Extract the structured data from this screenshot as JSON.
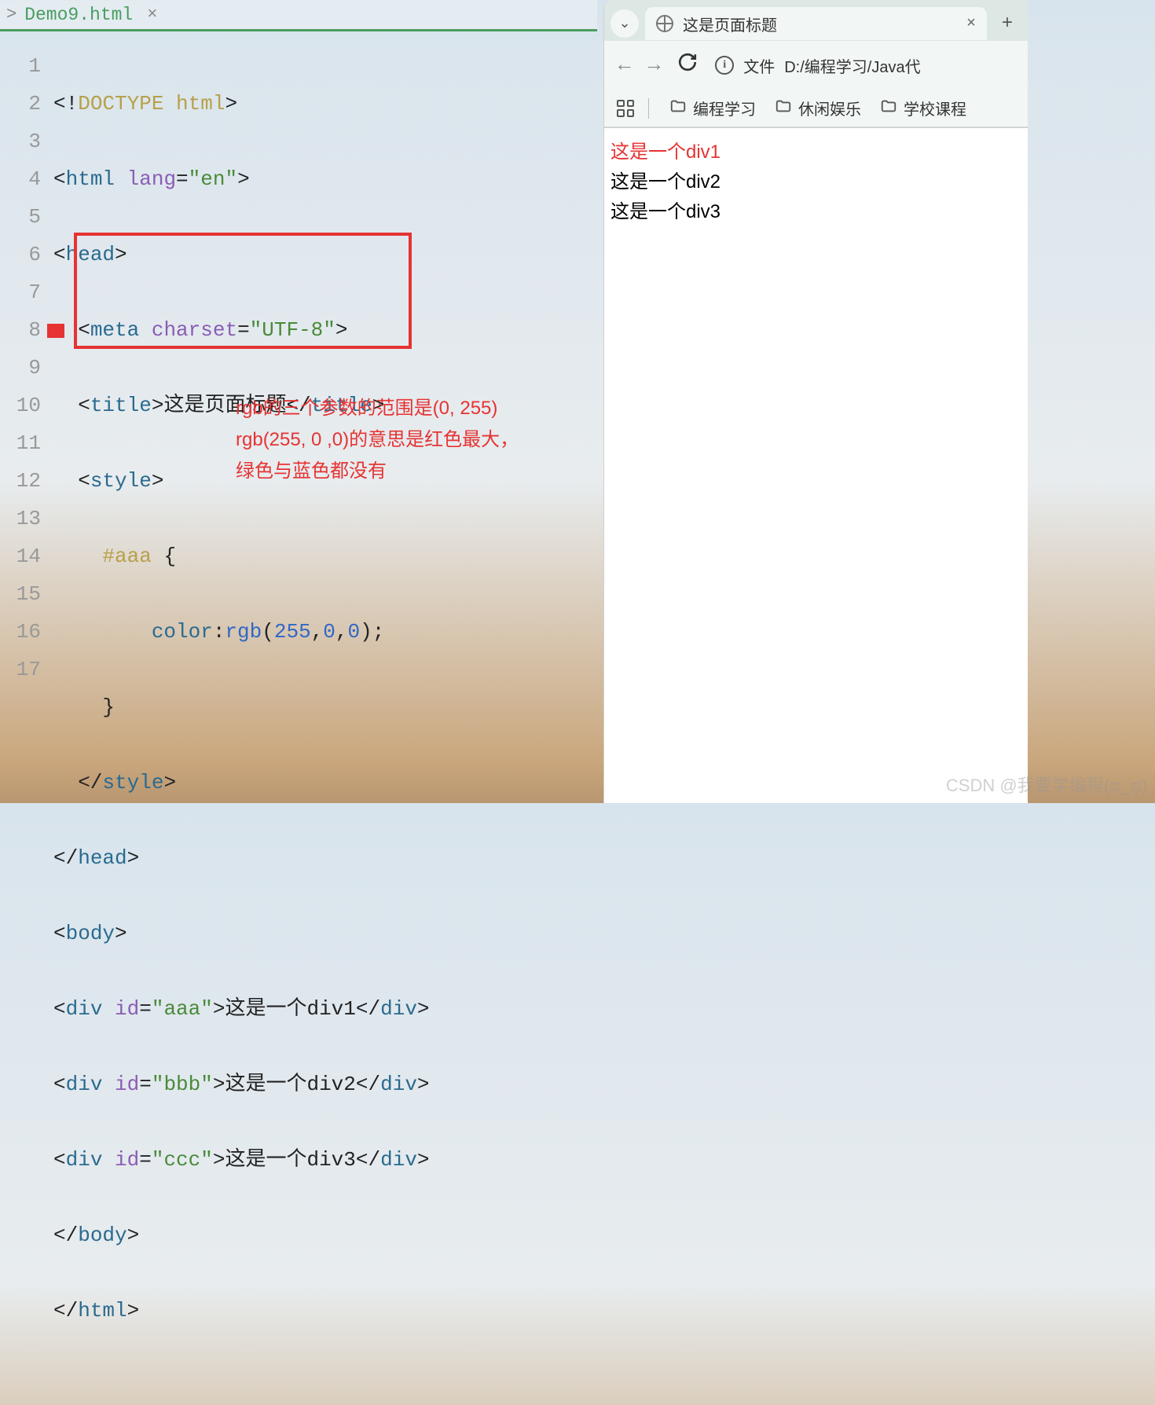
{
  "editor": {
    "tab_bread": ">",
    "tab_name": "Demo9.html",
    "tab_close": "×",
    "line_numbers": [
      "1",
      "2",
      "3",
      "4",
      "5",
      "6",
      "7",
      "8",
      "9",
      "10",
      "11",
      "12",
      "13",
      "14",
      "15",
      "16",
      "17"
    ],
    "code_tokens": [
      [
        "<!",
        "DOCTYPE html",
        ">"
      ],
      [
        "<",
        "html",
        " lang",
        "=",
        "\"en\"",
        ">"
      ],
      [
        "<",
        "head",
        ">"
      ],
      [
        "  <",
        "meta",
        " charset",
        "=",
        "\"UTF-8\"",
        ">"
      ],
      [
        "  <",
        "title",
        ">",
        "这是页面标题",
        "</",
        "title",
        ">"
      ],
      [
        "  <",
        "style",
        ">"
      ],
      [
        "    ",
        "#aaa",
        " {"
      ],
      [
        "        ",
        "color",
        ":",
        "rgb",
        "(",
        "255",
        ",",
        "0",
        ",",
        "0",
        ");"
      ],
      [
        "    }"
      ],
      [
        "  </",
        "style",
        ">"
      ],
      [
        "</",
        "head",
        ">"
      ],
      [
        "<",
        "body",
        ">"
      ],
      [
        "<",
        "div",
        " id",
        "=",
        "\"aaa\"",
        ">",
        "这是一个div1",
        "</",
        "div",
        ">"
      ],
      [
        "<",
        "div",
        " id",
        "=",
        "\"bbb\"",
        ">",
        "这是一个div2",
        "</",
        "div",
        ">"
      ],
      [
        "<",
        "div",
        " id",
        "=",
        "\"ccc\"",
        ">",
        "这是一个div3",
        "</",
        "div",
        ">"
      ],
      [
        "</",
        "body",
        ">"
      ],
      [
        "</",
        "html",
        ">"
      ]
    ],
    "annotation_line1": "rgb的三个参数的范围是(0, 255)",
    "annotation_line2": "rgb(255, 0 ,0)的意思是红色最大，",
    "annotation_line3": "绿色与蓝色都没有"
  },
  "browser": {
    "chevron": "⌄",
    "tab_title": "这是页面标题",
    "tab_close": "×",
    "new_tab": "+",
    "back": "←",
    "forward": "→",
    "url_label": "文件",
    "url_path": "D:/编程学习/Java代",
    "info_i": "i",
    "bookmarks": [
      {
        "label": "编程学习"
      },
      {
        "label": "休闲娱乐"
      },
      {
        "label": "学校课程"
      }
    ],
    "content": {
      "div1": "这是一个div1",
      "div2": "这是一个div2",
      "div3": "这是一个div3"
    }
  },
  "watermark": "CSDN @我要学编程(ಥ_ಥ)"
}
